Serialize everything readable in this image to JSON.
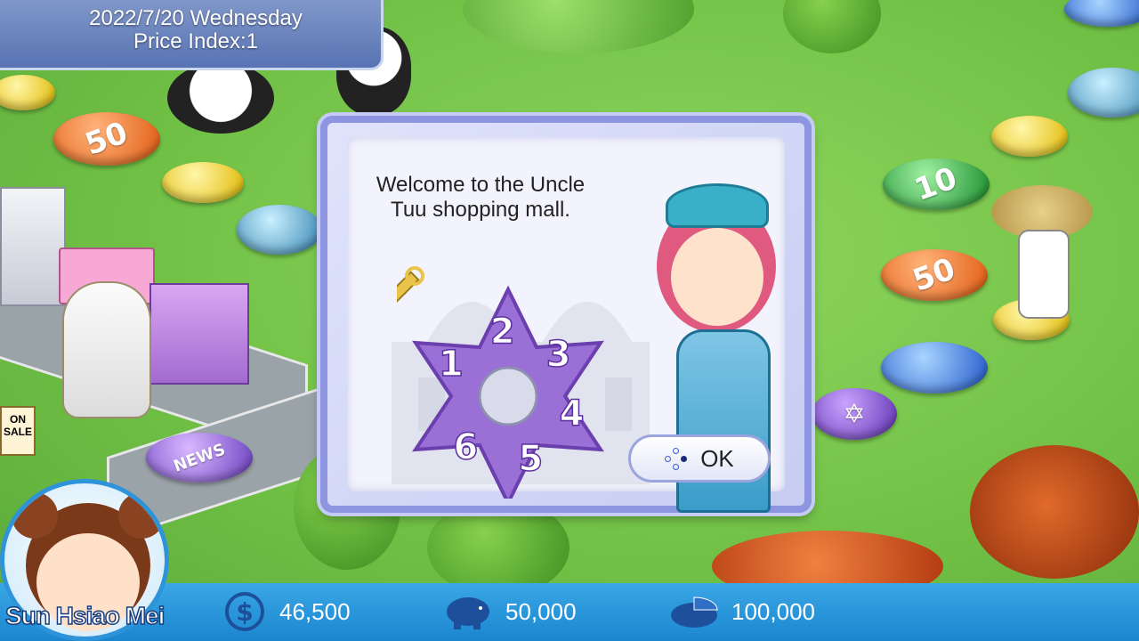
{
  "header": {
    "date": "2022/7/20 Wednesday",
    "price_index": "Price Index:1"
  },
  "board": {
    "tiles": [
      {
        "label": "50"
      },
      {
        "label": "10"
      },
      {
        "label": "50"
      }
    ],
    "signs": {
      "on_sale": "ON SALE",
      "news": "NEWS"
    }
  },
  "dialog": {
    "message": "Welcome to the Uncle Tuu shopping mall.",
    "dice_numbers": [
      "1",
      "2",
      "3",
      "4",
      "5",
      "6"
    ],
    "ok_label": "OK"
  },
  "status_bar": {
    "player_name": "Sun Hsiao Mei",
    "cash": "46,500",
    "savings": "50,000",
    "stocks": "100,000"
  },
  "colors": {
    "grass": "#7ec850",
    "dialog_border": "#8e95e0",
    "bar_blue": "#1b86cf",
    "dice_purple": "#9a6fd6"
  }
}
